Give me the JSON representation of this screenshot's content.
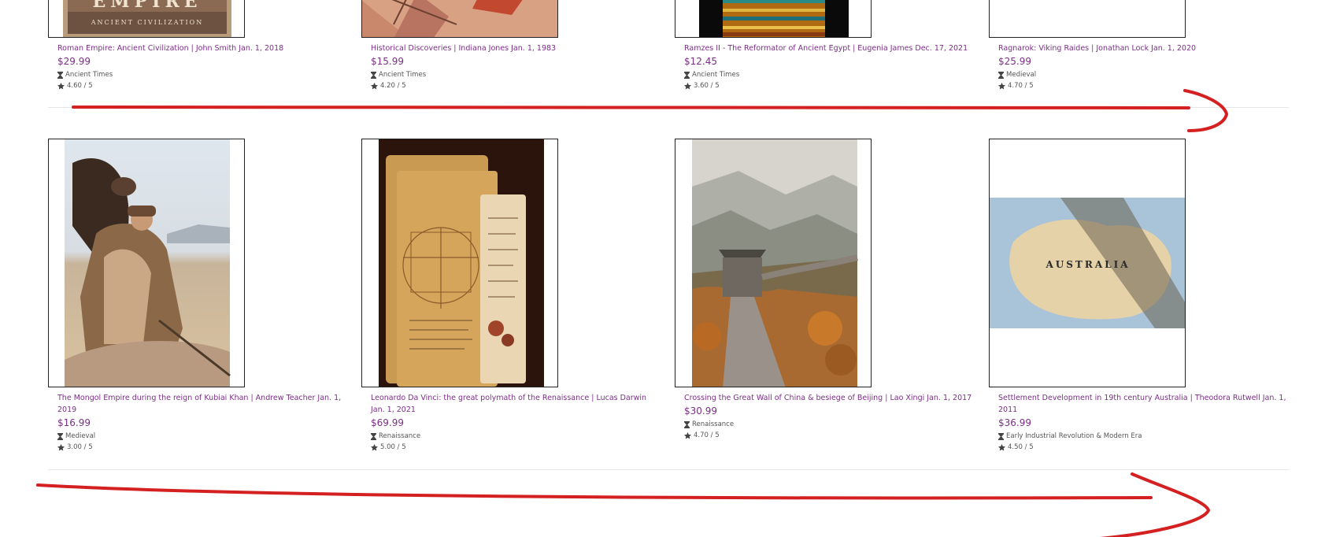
{
  "colors": {
    "accent": "#7b2f86",
    "annotation": "#d42020",
    "divider": "#e6e6e6"
  },
  "row1": [
    {
      "title": "Roman Empire: Ancient Civilization | John Smith Jan. 1, 2018",
      "price": "$29.99",
      "era": "Ancient Times",
      "rating": "4.60 / 5",
      "cover_text": {
        "line1": "EMPIRE",
        "line2": "ANCIENT CIVILIZATION"
      }
    },
    {
      "title": "Historical Discoveries | Indiana Jones Jan. 1, 1983",
      "price": "$15.99",
      "era": "Ancient Times",
      "rating": "4.20 / 5"
    },
    {
      "title": "Ramzes II - The Reformator of Ancient Egypt | Eugenia James Dec. 17, 2021",
      "price": "$12.45",
      "era": "Ancient Times",
      "rating": "3.60 / 5"
    },
    {
      "title": "Ragnarok: Viking Raides | Jonathan Lock Jan. 1, 2020",
      "price": "$25.99",
      "era": "Medieval",
      "rating": "4.70 / 5"
    }
  ],
  "row2": [
    {
      "title": "The Mongol Empire during the reign of Kubiai Khan | Andrew Teacher Jan. 1, 2019",
      "price": "$16.99",
      "era": "Medieval",
      "rating": "3.00 / 5"
    },
    {
      "title": "Leonardo Da Vinci: the great polymath of the Renaissance | Lucas Darwin Jan. 1, 2021",
      "price": "$69.99",
      "era": "Renaissance",
      "rating": "5.00 / 5"
    },
    {
      "title": "Crossing the Great Wall of China & besiege of Beijing | Lao Xingi Jan. 1, 2017",
      "price": "$30.99",
      "era": "Renaissance",
      "rating": "4.70 / 5"
    },
    {
      "title": "Settlement Development in 19th century Australia | Theodora Rutwell Jan. 1, 2011",
      "price": "$36.99",
      "era": "Early Industrial Revolution & Modern Era",
      "rating": "4.50 / 5",
      "map_label": "AUSTRALIA"
    }
  ]
}
